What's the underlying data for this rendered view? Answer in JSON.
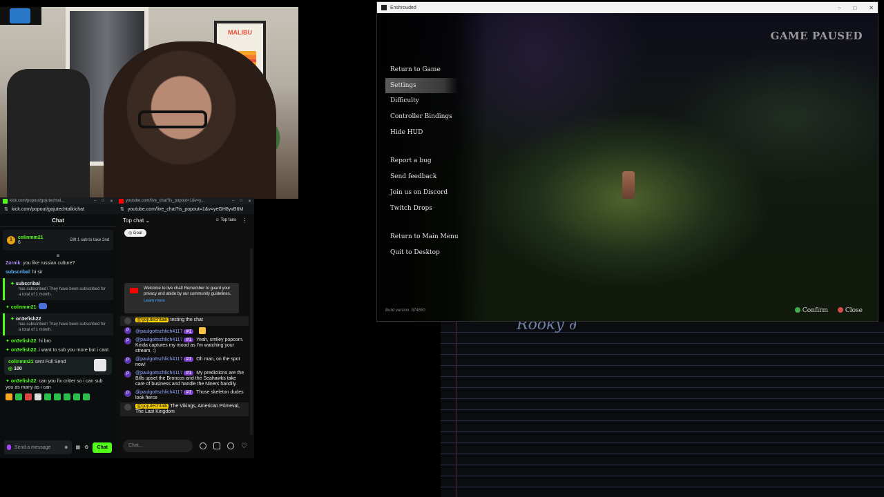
{
  "kick": {
    "tab_url": "kick.com/popout/gojutechtal...",
    "address": "kick.com/popout/gojutechtalk/chat",
    "title": "Chat",
    "pinned": {
      "name": "colinmm21",
      "count": "6",
      "note": "Gift 1 sub to take 2nd"
    },
    "messages": [
      {
        "user": "Zornik",
        "text": ": you like russian culture?",
        "color": "#b48cff"
      },
      {
        "user": "subscribal",
        "text": ": hi sir",
        "color": "#5fb7ff"
      }
    ],
    "sub_events": [
      {
        "user": "subscribal",
        "text": "has subscribed! They have been subscribed for a total of 1 month."
      },
      {
        "user": "on3efish22",
        "text": "has subscribed! They have been subscribed for a total of 1 month."
      }
    ],
    "messages2": [
      {
        "user": "colinmm21",
        "text": ":"
      },
      {
        "user": "on3efish22",
        "text": ": hi bro"
      },
      {
        "user": "on3efish22",
        "text": ": i want to sub you more but i cant"
      }
    ],
    "send": {
      "user": "colinmm21",
      "text": "sent Full Send",
      "amount": "100"
    },
    "messages3": [
      {
        "user": "on3efish22",
        "text": ": can you fix critter so i can sub you as many as i can"
      }
    ],
    "input_placeholder": "Send a message",
    "chat_button": "Chat"
  },
  "youtube": {
    "tab_url": "youtube.com/live_chat?is_popout=1&v=y...",
    "address": "youtube.com/live_chat?is_popout=1&v=yeGH8yvBItM",
    "header": "Top chat",
    "top_fans": "Top fans",
    "goal": "Goal",
    "welcome": "Welcome to live chat! Remember to guard your privacy and abide by our community guidelines.",
    "learn_more": "Learn more",
    "messages": [
      {
        "avatar": "",
        "name": "@gojutechtalk",
        "owner": true,
        "badge": "",
        "text": "testing the chat",
        "highlight": true
      },
      {
        "avatar": "P",
        "name": "@paulgottschlich4117",
        "owner": false,
        "badge": "#1",
        "text": "",
        "highlight": false
      },
      {
        "avatar": "P",
        "name": "@paulgottschlich4117",
        "owner": false,
        "badge": "#1",
        "text": "Yeah, smiley popcorn. Kinda captures my mood as I'm watching your stream. :)",
        "highlight": false
      },
      {
        "avatar": "P",
        "name": "@paulgottschlich4117",
        "owner": false,
        "badge": "#1",
        "text": "Oh man, on the spot now!",
        "highlight": false
      },
      {
        "avatar": "P",
        "name": "@paulgottschlich4117",
        "owner": false,
        "badge": "#1",
        "text": "My predictions are the Bills upset the Broncos and the Seahawks take care of business and handle the Niners handily.",
        "highlight": false
      },
      {
        "avatar": "P",
        "name": "@paulgottschlich4117",
        "owner": false,
        "badge": "#1",
        "text": "Those skeleton dudes look fierce",
        "highlight": false
      },
      {
        "avatar": "",
        "name": "@gojutechtalk",
        "owner": true,
        "badge": "",
        "text": "The Vikings, American Primeval, The Last Kingdom",
        "highlight": true
      }
    ],
    "input_placeholder": "Chat..."
  },
  "game": {
    "window_title": "Enshrouded",
    "paused_label": "GAME PAUSED",
    "menu_group1": [
      "Return to Game",
      "Settings",
      "Difficulty",
      "Controller Bindings",
      "Hide HUD"
    ],
    "menu_group2": [
      "Report a bug",
      "Send feedback",
      "Join us on Discord",
      "Twitch Drops"
    ],
    "menu_group3": [
      "Return to Main Menu",
      "Quit to Desktop"
    ],
    "selected": "Settings",
    "build_version": "Build version:  874650",
    "confirm": "Confirm",
    "close": "Close",
    "confirm_color": "#3fae49",
    "close_color": "#d84b4b"
  },
  "webcam": {
    "poster_text": "MALIBU"
  },
  "notebook": {
    "scribble": "Rooky ∂"
  },
  "colors": {
    "kick_green": "#53fc18",
    "yt_red": "#ff0000"
  }
}
